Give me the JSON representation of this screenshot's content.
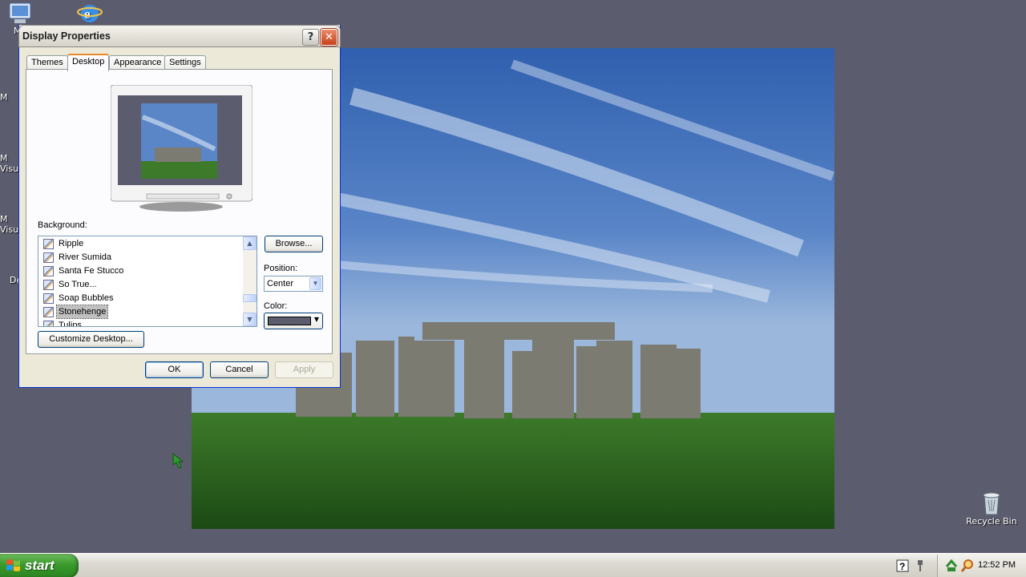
{
  "desktop": {
    "icons": [
      {
        "name": "my-computer",
        "label": "My"
      },
      {
        "name": "internet-explorer",
        "label": ""
      },
      {
        "name": "recycle-bin",
        "label": "Recycle Bin"
      }
    ],
    "clipped_labels": [
      "M",
      "M",
      "Visu",
      "M",
      "Visu",
      "De"
    ]
  },
  "dialog": {
    "title": "Display Properties",
    "help_label": "?",
    "close_label": "✕",
    "tabs": [
      {
        "label": "Themes",
        "active": false
      },
      {
        "label": "Desktop",
        "active": true
      },
      {
        "label": "Appearance",
        "active": false
      },
      {
        "label": "Settings",
        "active": false
      }
    ],
    "background_label": "Background:",
    "background_items": [
      {
        "label": "Ripple",
        "selected": false
      },
      {
        "label": "River Sumida",
        "selected": false
      },
      {
        "label": "Santa Fe Stucco",
        "selected": false
      },
      {
        "label": "So True...",
        "selected": false
      },
      {
        "label": "Soap Bubbles",
        "selected": false
      },
      {
        "label": "Stonehenge",
        "selected": true
      },
      {
        "label": "Tulips",
        "selected": false
      }
    ],
    "browse_label": "Browse...",
    "position_label": "Position:",
    "position_value": "Center",
    "color_label": "Color:",
    "color_value": "#5c5c6f",
    "customize_label": "Customize Desktop...",
    "ok_label": "OK",
    "cancel_label": "Cancel",
    "apply_label": "Apply"
  },
  "taskbar": {
    "start_label": "start",
    "clock": "12:52 PM"
  },
  "colors": {
    "desktop_bg": "#5c5c6f",
    "start_green": "#3a9a2c",
    "xp_blue": "#0831d9"
  }
}
